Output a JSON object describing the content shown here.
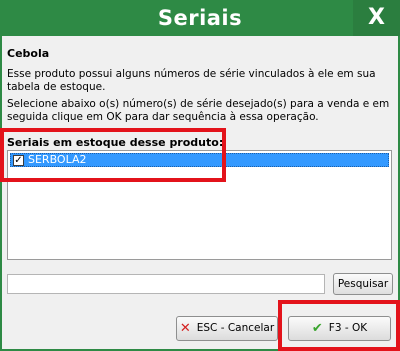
{
  "window": {
    "title": "Seriais",
    "close_label": "X"
  },
  "product": {
    "name": "Cebola",
    "description_1": "Esse produto possui alguns números de série vinculados à ele em sua tabela de estoque.",
    "description_2": "Selecione abaixo o(s) número(s) de série desejado(s) para a venda e em seguida clique em OK para dar sequência à essa operação."
  },
  "serials": {
    "label": "Seriais em estoque desse produto:",
    "items": [
      {
        "label": "SERBOLA2",
        "checked": true,
        "check_mark": "✓"
      }
    ]
  },
  "search": {
    "value": "",
    "placeholder": "",
    "button_label": "Pesquisar"
  },
  "actions": {
    "cancel_label": "ESC - Cancelar",
    "ok_label": "F3 - OK"
  },
  "colors": {
    "titlebar": "#2e8a45",
    "selection": "#3399ff",
    "highlight": "#e3131b"
  }
}
